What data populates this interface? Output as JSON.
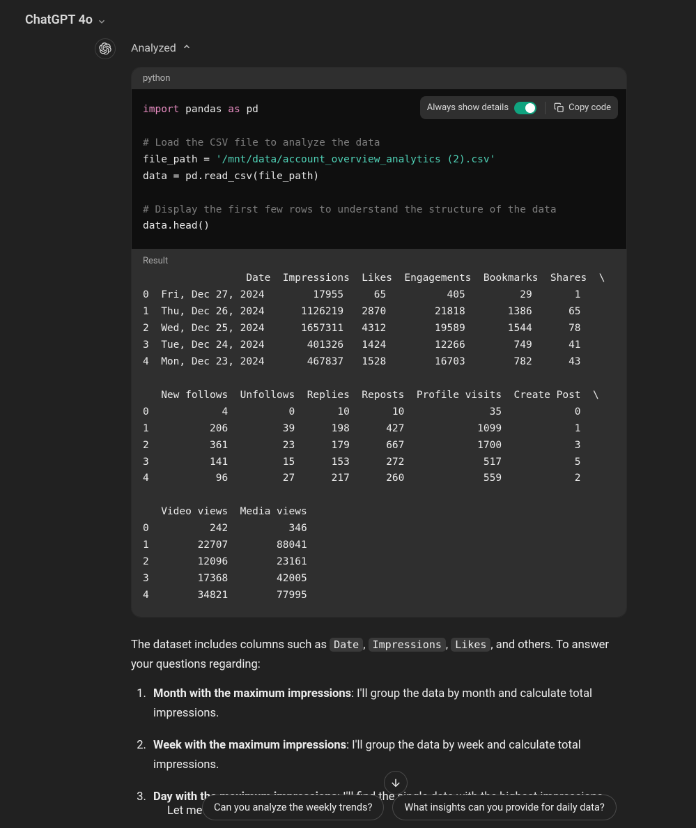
{
  "header": {
    "model": "ChatGPT 4o"
  },
  "status": {
    "analyzed": "Analyzed"
  },
  "code": {
    "language": "python",
    "always_show_details": "Always show details",
    "copy": "Copy code",
    "kw_import": "import",
    "pandas": "pandas",
    "kw_as": "as",
    "pd": "pd",
    "comment1": "# Load the CSV file to analyze the data",
    "fp_assign": "file_path = ",
    "fp_string": "'/mnt/data/account_overview_analytics (2).csv'",
    "read_line": "data = pd.read_csv(file_path)",
    "comment2": "# Display the first few rows to understand the structure of the data",
    "head_line": "data.head()"
  },
  "result": {
    "label": "Result",
    "text": "                 Date  Impressions  Likes  Engagements  Bookmarks  Shares  \\\n0  Fri, Dec 27, 2024        17955     65          405         29       1   \n1  Thu, Dec 26, 2024      1126219   2870        21818       1386      65   \n2  Wed, Dec 25, 2024      1657311   4312        19589       1544      78   \n3  Tue, Dec 24, 2024       401326   1424        12266        749      41   \n4  Mon, Dec 23, 2024       467837   1528        16703        782      43   \n\n   New follows  Unfollows  Replies  Reposts  Profile visits  Create Post  \\\n0            4          0       10       10              35            0   \n1          206         39      198      427            1099            1   \n2          361         23      179      667            1700            3   \n3          141         15      153      272             517            5   \n4           96         27      217      260             559            2   \n\n   Video views  Media views  \n0          242          346  \n1        22707        88041  \n2        12096        23161  \n3        17368        42005  \n4        34821        77995  "
  },
  "prose": {
    "intro_a": "The dataset includes columns such as ",
    "c1": "Date",
    "sep": ", ",
    "c2": "Impressions",
    "c3": "Likes",
    "intro_b": ", and others. To answer your questions regarding:",
    "li1b": "Month with the maximum impressions",
    "li1t": ": I'll group the data by month and calculate total impressions.",
    "li2b": "Week with the maximum impressions",
    "li2t": ": I'll group the data by week and calculate total impressions.",
    "li3b": "Day with the maximum impressions",
    "li3t": ": I'll find the single date with the highest impressions.",
    "outro": "Let me p"
  },
  "suggestions": {
    "s1": "Can you analyze the weekly trends?",
    "s2": "What insights can you provide for daily data?"
  }
}
